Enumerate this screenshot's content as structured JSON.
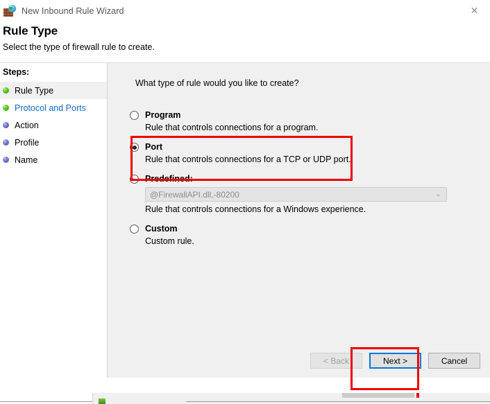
{
  "window": {
    "title": "New Inbound Rule Wizard",
    "icon": "firewall-icon",
    "close_label": "✕"
  },
  "header": {
    "title": "Rule Type",
    "subtitle": "Select the type of firewall rule to create."
  },
  "sidebar": {
    "label": "Steps:",
    "items": [
      {
        "label": "Rule Type",
        "bullet": "green",
        "state": "current"
      },
      {
        "label": "Protocol and Ports",
        "bullet": "green",
        "state": "link"
      },
      {
        "label": "Action",
        "bullet": "blue",
        "state": "normal"
      },
      {
        "label": "Profile",
        "bullet": "blue",
        "state": "normal"
      },
      {
        "label": "Name",
        "bullet": "blue",
        "state": "normal"
      }
    ]
  },
  "main": {
    "question": "What type of rule would you like to create?",
    "options": [
      {
        "title": "Program",
        "description": "Rule that controls connections for a program.",
        "selected": false
      },
      {
        "title": "Port",
        "description": "Rule that controls connections for a TCP or UDP port.",
        "selected": true
      },
      {
        "title": "Predefined:",
        "description": "Rule that controls connections for a Windows experience.",
        "selected": false,
        "combo_value": "@FirewallAPI.dll,-80200",
        "combo_arrow": "⌄"
      },
      {
        "title": "Custom",
        "description": "Custom rule.",
        "selected": false
      }
    ]
  },
  "footer": {
    "back_label": "< Back",
    "next_label": "Next >",
    "cancel_label": "Cancel"
  },
  "annotations": {
    "color": "#ee0000",
    "targets": [
      "port-option",
      "next-button"
    ]
  }
}
